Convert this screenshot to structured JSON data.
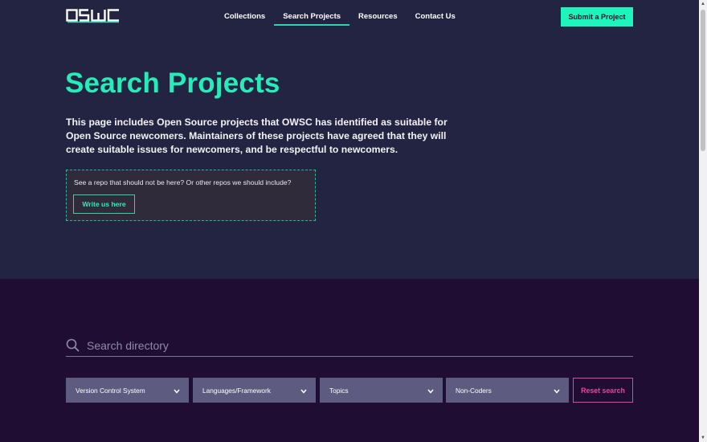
{
  "header": {
    "logo_text": "OSWC",
    "nav": [
      {
        "label": "Collections",
        "active": false
      },
      {
        "label": "Search Projects",
        "active": true
      },
      {
        "label": "Resources",
        "active": false
      },
      {
        "label": "Contact Us",
        "active": false
      }
    ],
    "submit_label": "Submit a Project"
  },
  "hero": {
    "title": "Search Projects",
    "intro": "This page includes Open Source projects that OWSC has identified as suitable for Open Source newcomers. Maintainers of these projects have agreed that they will create suitable issues for newcomers, and be respectful to newcomers.",
    "notice_text": "See a repo that should not be here? Or other repos we should include?",
    "notice_button": "Write us here"
  },
  "search": {
    "placeholder": "Search directory",
    "value": ""
  },
  "filters": [
    {
      "label": "Version Control System"
    },
    {
      "label": "Languages/Framework"
    },
    {
      "label": "Topics"
    },
    {
      "label": "Non-Coders"
    }
  ],
  "reset_label": "Reset search",
  "colors": {
    "hero_bg": "#232442",
    "lower_bg": "#1f0d33",
    "accent": "#1ef5bd",
    "title": "#27ebb8",
    "filter_bg": "#5e5b80",
    "reset": "#e8469b"
  },
  "icons": [
    "logo",
    "search-icon",
    "chevron-down-icon"
  ]
}
